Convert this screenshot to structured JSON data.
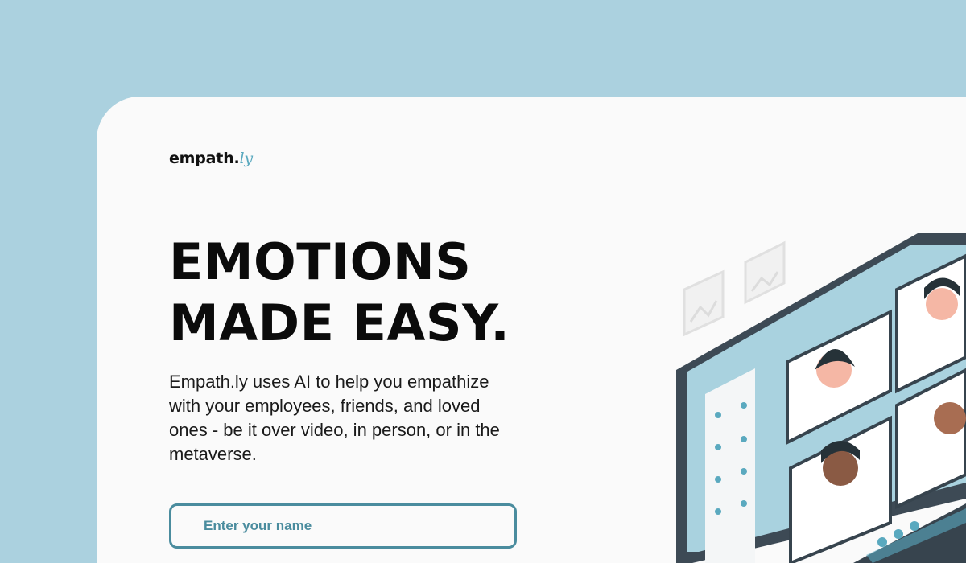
{
  "brand": {
    "name": "empath.",
    "suffix": "ly"
  },
  "hero": {
    "headline_line1": "EMOTIONS",
    "headline_line2": "MADE EASY.",
    "description": "Empath.ly uses AI to help you empathize\nwith  your employees, friends, and loved\nones - be it  over video, in person, or in the\nmetaverse."
  },
  "form": {
    "name_placeholder": "Enter your name",
    "name_value": ""
  },
  "illustration": {
    "subject": "video-call-laptop",
    "icons": [
      "picture-frame-icon",
      "video-call-icon"
    ]
  },
  "colors": {
    "background": "#abd1df",
    "card": "#fafafa",
    "accent": "#4a8c9e",
    "text": "#0b0b0b"
  }
}
